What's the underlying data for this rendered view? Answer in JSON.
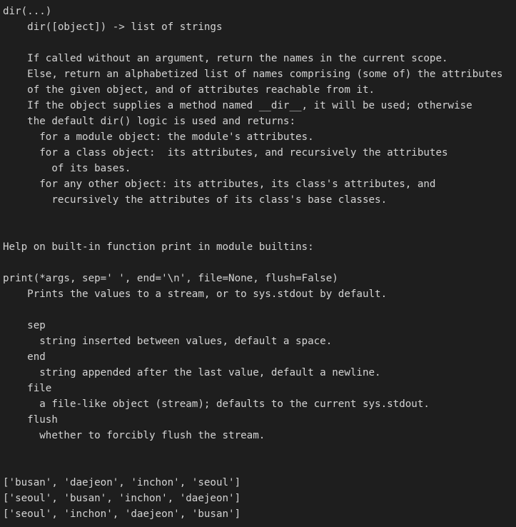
{
  "help_dir": {
    "signature": "dir(...)",
    "usage": "    dir([object]) -> list of strings",
    "desc_1": "    If called without an argument, return the names in the current scope.",
    "desc_2": "    Else, return an alphabetized list of names comprising (some of) the attributes",
    "desc_3": "    of the given object, and of attributes reachable from it.",
    "desc_4": "    If the object supplies a method named __dir__, it will be used; otherwise",
    "desc_5": "    the default dir() logic is used and returns:",
    "desc_6": "      for a module object: the module's attributes.",
    "desc_7": "      for a class object:  its attributes, and recursively the attributes",
    "desc_8": "        of its bases.",
    "desc_9": "      for any other object: its attributes, its class's attributes, and",
    "desc_10": "        recursively the attributes of its class's base classes."
  },
  "help_print": {
    "header": "Help on built-in function print in module builtins:",
    "signature": "print(*args, sep=' ', end='\\n', file=None, flush=False)",
    "summary": "    Prints the values to a stream, or to sys.stdout by default.",
    "param_sep": "    sep",
    "param_sep_desc": "      string inserted between values, default a space.",
    "param_end": "    end",
    "param_end_desc": "      string appended after the last value, default a newline.",
    "param_file": "    file",
    "param_file_desc": "      a file-like object (stream); defaults to the current sys.stdout.",
    "param_flush": "    flush",
    "param_flush_desc": "      whether to forcibly flush the stream."
  },
  "outputs": [
    "['busan', 'daejeon', 'inchon', 'seoul']",
    "['seoul', 'busan', 'inchon', 'daejeon']",
    "['seoul', 'inchon', 'daejeon', 'busan']"
  ]
}
